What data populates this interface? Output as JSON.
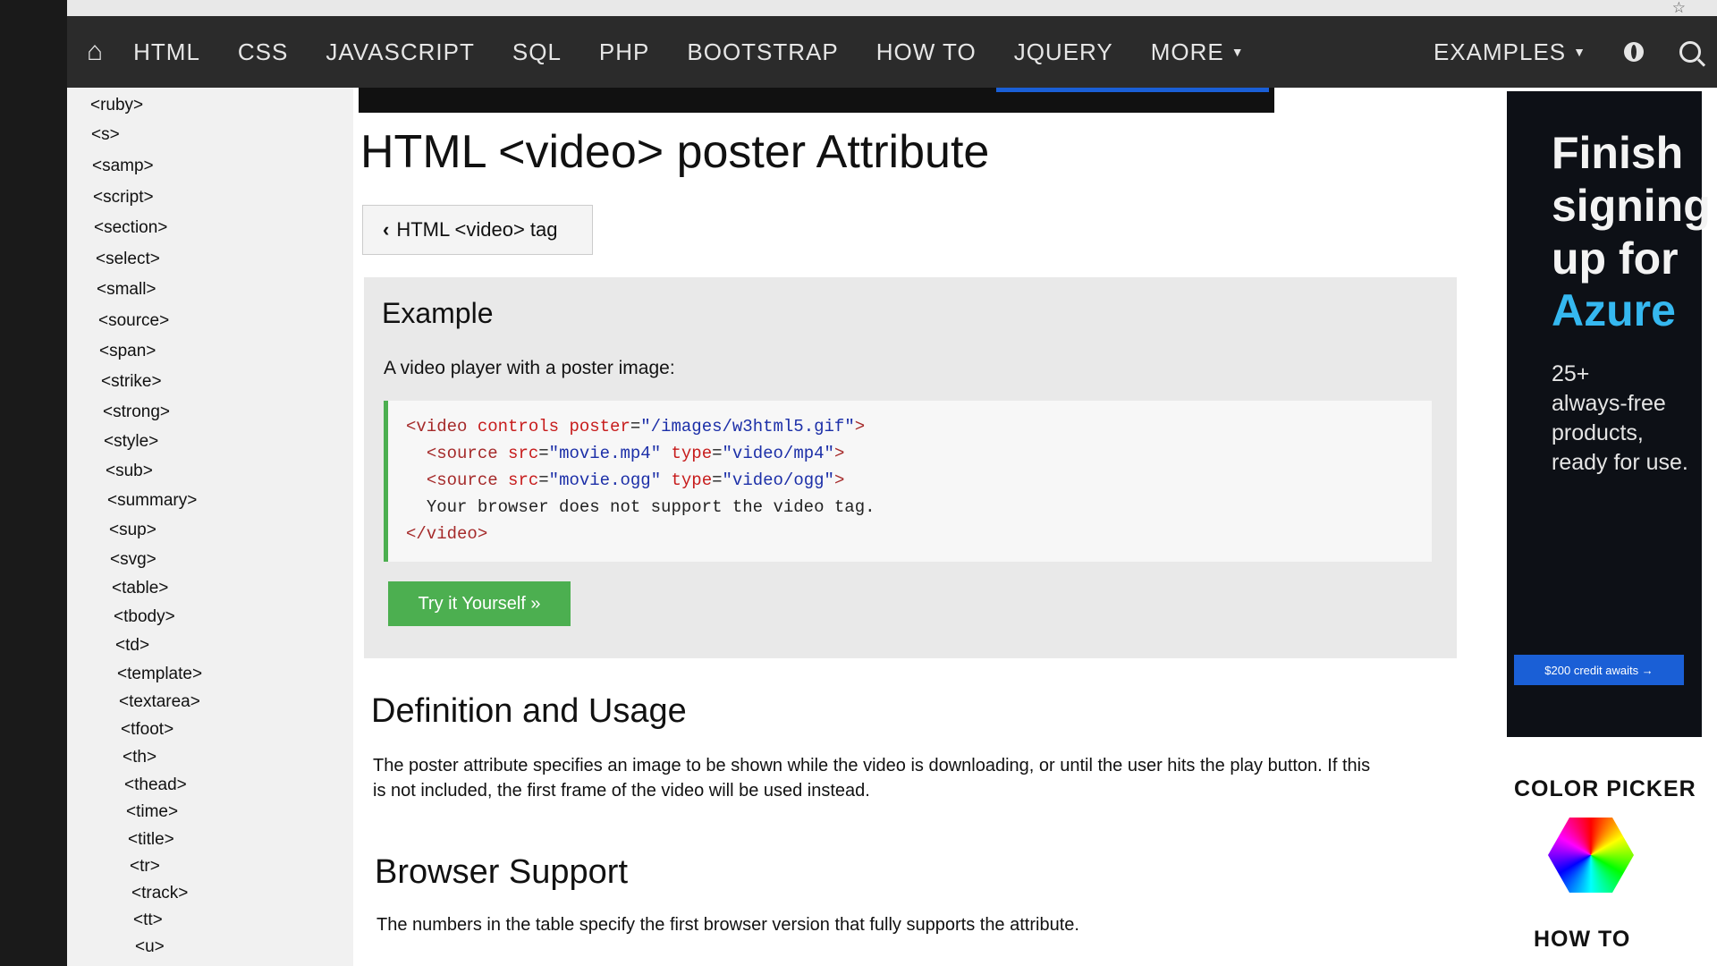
{
  "nav": {
    "items": [
      "HTML",
      "CSS",
      "JAVASCRIPT",
      "SQL",
      "PHP",
      "BOOTSTRAP",
      "HOW TO",
      "JQUERY"
    ],
    "more": "MORE",
    "examples": "EXAMPLES"
  },
  "sidebar": {
    "items": [
      "<ruby>",
      "<s>",
      "<samp>",
      "<script>",
      "<section>",
      "<select>",
      "<small>",
      "<source>",
      "<span>",
      "<strike>",
      "<strong>",
      "<style>",
      "<sub>",
      "<summary>",
      "<sup>",
      "<svg>",
      "<table>",
      "<tbody>",
      "<td>",
      "<template>",
      "<textarea>",
      "<tfoot>",
      "<th>",
      "<thead>",
      "<time>",
      "<title>",
      "<tr>",
      "<track>",
      "<tt>",
      "<u>"
    ]
  },
  "main": {
    "title": "HTML <video> poster Attribute",
    "back_label": "HTML <video> tag",
    "example": {
      "title": "Example",
      "description": "A video player with a poster image:",
      "code": {
        "l1_tag_open": "<video",
        "l1_attr1": "controls",
        "l1_attr2": "poster",
        "l1_eq": "=",
        "l1_val": "\"/images/w3html5.gif\"",
        "l1_close": ">",
        "l2_tag": "<source",
        "l2_attr1": "src",
        "l2_val1": "\"movie.mp4\"",
        "l2_attr2": "type",
        "l2_val2": "\"video/mp4\"",
        "l2_close": ">",
        "l3_tag": "<source",
        "l3_attr1": "src",
        "l3_val1": "\"movie.ogg\"",
        "l3_attr2": "type",
        "l3_val2": "\"video/ogg\"",
        "l3_close": ">",
        "l4_text": "Your browser does not support the video tag.",
        "l5_close": "</video>"
      },
      "try_label": "Try it Yourself »"
    },
    "definition": {
      "title": "Definition and Usage",
      "text": "The poster attribute specifies an image to be shown while the video is downloading, or until the user hits the play button. If this is not included, the first frame of the video will be used instead."
    },
    "support": {
      "title": "Browser Support",
      "text": "The numbers in the table specify the first browser version that fully supports the attribute."
    }
  },
  "ad": {
    "line1": "Finish",
    "line2": "signing",
    "line3": "up for",
    "accent": "Azure",
    "sub1": "25+",
    "sub2": "always-free",
    "sub3": "products,",
    "sub4": "ready for use.",
    "cta": "$200 credit awaits →",
    "colors": {
      "background": "#0d1016",
      "accent": "#35b8f0",
      "cta": "#1a5fd6"
    }
  },
  "right": {
    "color_picker_title": "COLOR PICKER",
    "howto_title": "HOW TO"
  },
  "colors": {
    "nav_bg": "#2b2b2b",
    "sidebar_bg": "#f1f1f1",
    "example_bg": "#e9e9e9",
    "try_button": "#4caf50",
    "code_border": "#4caf50"
  },
  "icons": {
    "home": "home-icon",
    "globe": "globe-icon",
    "search": "search-icon",
    "star": "star-icon",
    "back": "chevron-left-icon",
    "dropdown": "caret-down-icon",
    "color_picker": "color-hexagon-icon"
  }
}
